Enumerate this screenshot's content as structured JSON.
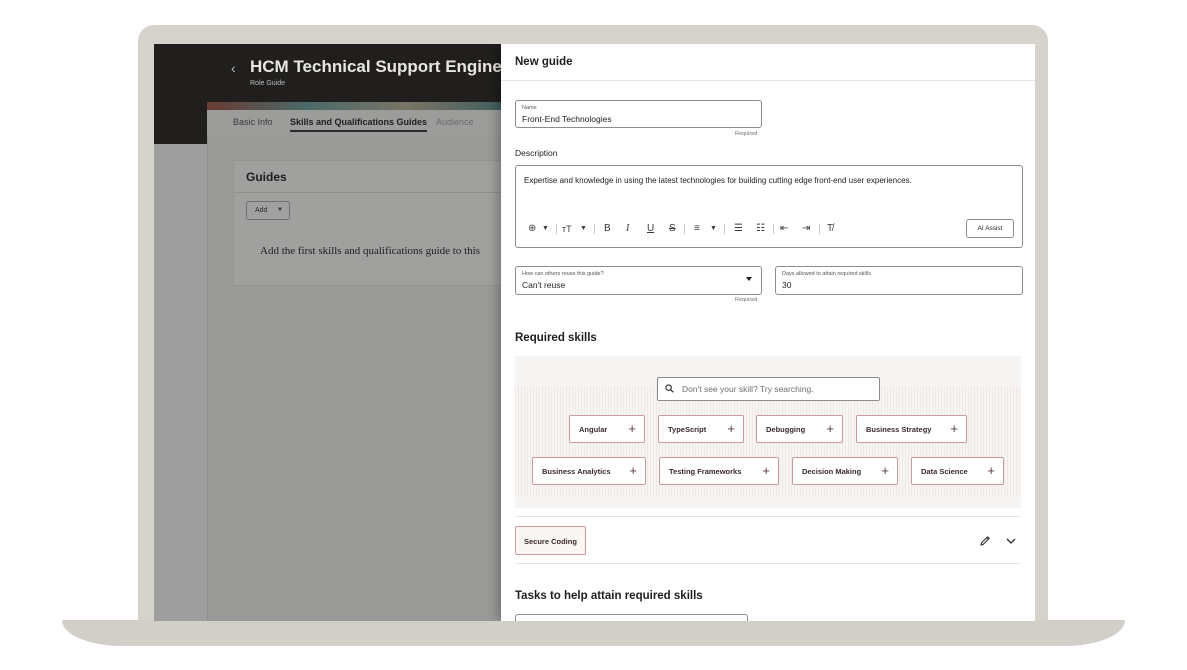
{
  "background_app": {
    "back_glyph": "‹",
    "title": "HCM Technical Support Engineer",
    "subtitle": "Role Guide",
    "tabs": [
      "Basic Info",
      "Skills and Qualifications Guides",
      "Audience"
    ],
    "card": {
      "title": "Guides",
      "add_label": "Add",
      "empty_text": "Add the first skills and qualifications guide to this"
    }
  },
  "drawer": {
    "title": "New guide",
    "name_field": {
      "label": "Name",
      "value": "Front-End Technologies",
      "helper": "Required"
    },
    "description": {
      "label": "Description",
      "text": "Expertise and knowledge in using the latest technologies for building cutting edge front-end user experiences.",
      "ai_button": "AI Assist",
      "toolbar_icons": [
        "insert-icon",
        "text-size-icon",
        "bold-icon",
        "italic-icon",
        "underline-icon",
        "strikethrough-icon",
        "align-icon",
        "bullet-list-icon",
        "numbered-list-icon",
        "outdent-icon",
        "indent-icon",
        "clear-format-icon"
      ]
    },
    "reuse_field": {
      "label": "How can others reuse this guide?",
      "value": "Can't reuse",
      "helper": "Required"
    },
    "days_field": {
      "label": "Days allowed to attain required skills",
      "value": "30"
    },
    "required_skills": {
      "heading": "Required skills",
      "search_placeholder": "Don't see your skill? Try searching.",
      "suggested_row1": [
        "Angular",
        "TypeScript",
        "Debugging",
        "Business Strategy"
      ],
      "suggested_row2": [
        "Business Analytics",
        "Testing Frameworks",
        "Decision Making",
        "Data Science"
      ],
      "selected": [
        "Secure Coding"
      ]
    },
    "tasks": {
      "heading": "Tasks to help attain required skills"
    }
  },
  "colors": {
    "accent_chip_border": "#c99b9c",
    "header_dark": "#201f1d",
    "frame": "#d6d2cc"
  }
}
